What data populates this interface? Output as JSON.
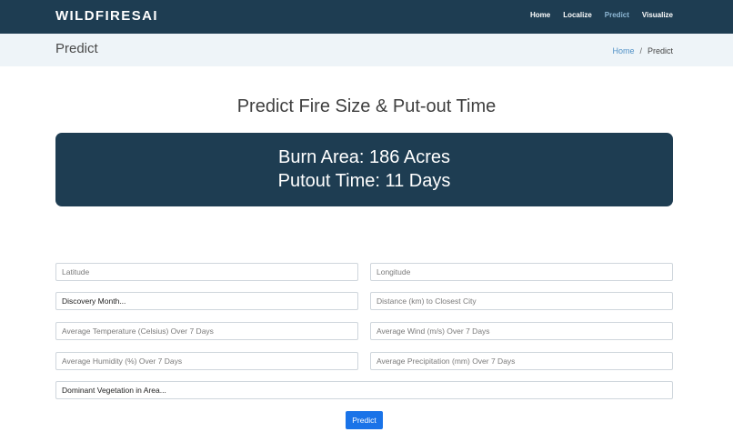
{
  "nav": {
    "brand": "WILDFIRESAI",
    "items": [
      {
        "label": "Home"
      },
      {
        "label": "Localize"
      },
      {
        "label": "Predict"
      },
      {
        "label": "Visualize"
      }
    ]
  },
  "titlebar": {
    "title": "Predict",
    "breadcrumb": {
      "home": "Home",
      "separator": "/",
      "current": "Predict"
    }
  },
  "main": {
    "heading": "Predict Fire Size & Put-out Time",
    "result": {
      "burn_area": "Burn Area: 186 Acres",
      "putout_time": "Putout Time: 11 Days"
    },
    "form": {
      "latitude_placeholder": "Latitude",
      "longitude_placeholder": "Longitude",
      "discovery_month_selected": "Discovery Month...",
      "distance_placeholder": "Distance (km) to Closest City",
      "temperature_placeholder": "Average Temperature (Celsius) Over 7 Days",
      "wind_placeholder": "Average Wind (m/s) Over 7 Days",
      "humidity_placeholder": "Average Humidity (%) Over 7 Days",
      "precipitation_placeholder": "Average Precipitation (mm) Over 7 Days",
      "vegetation_selected": "Dominant Vegetation in Area...",
      "submit_label": "Predict"
    }
  },
  "colors": {
    "navbar_bg": "#1e3d52",
    "active_nav": "#8fb9d6",
    "titlebar_bg": "#eef4f8",
    "button_bg": "#1a73e8"
  }
}
